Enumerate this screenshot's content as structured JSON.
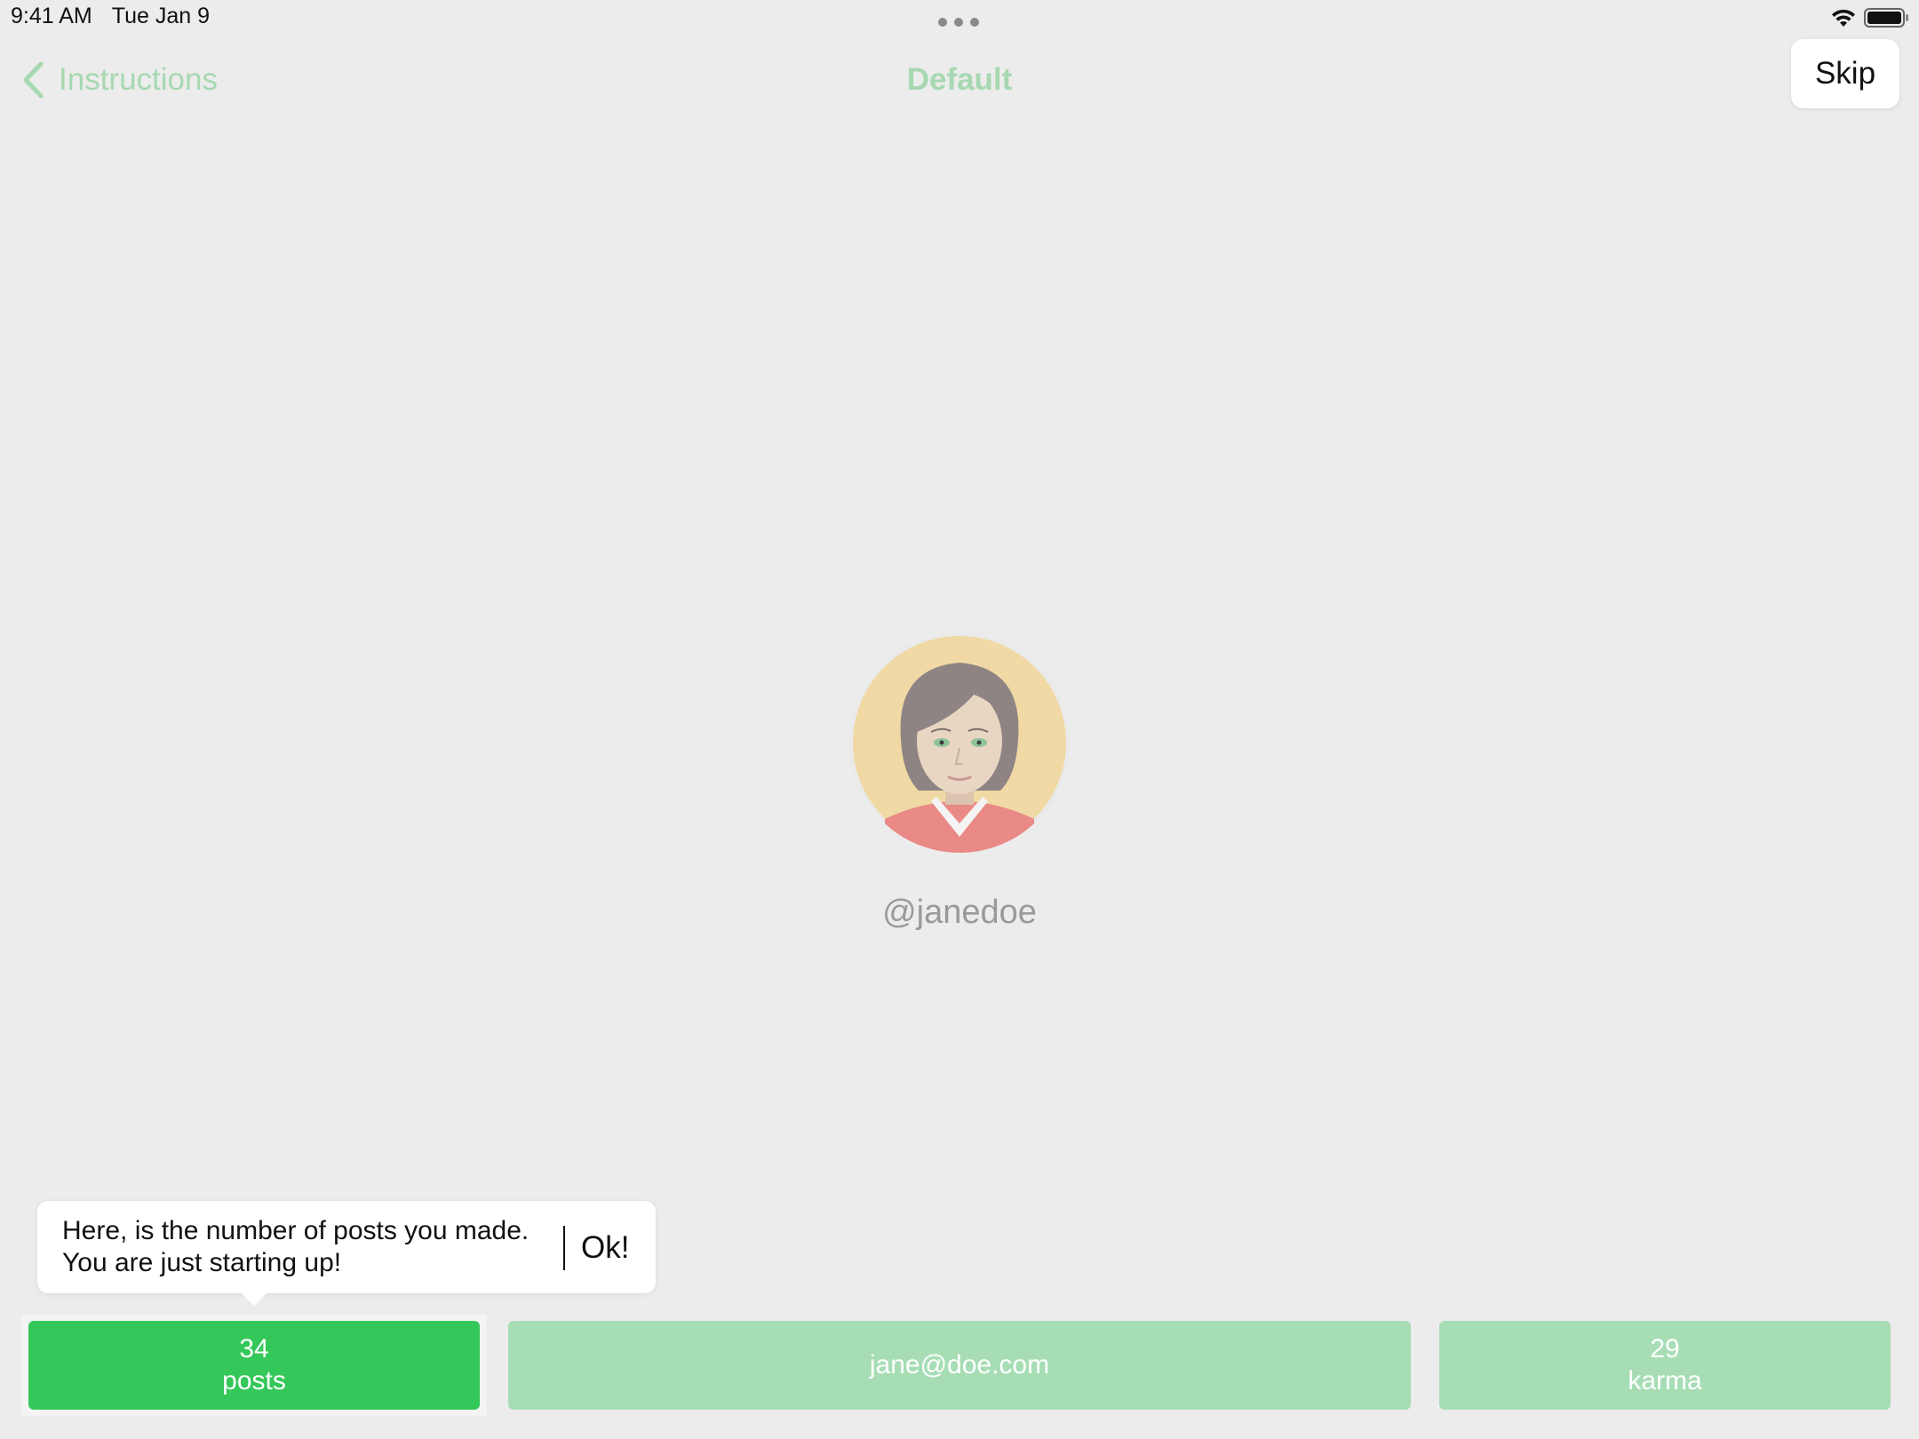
{
  "status_bar": {
    "time": "9:41 AM",
    "date": "Tue Jan 9",
    "wifi_icon": "wifi-icon",
    "battery_icon": "battery-full-icon"
  },
  "nav": {
    "back_label": "Instructions",
    "title": "Default",
    "skip_label": "Skip",
    "accent_color": "#a7d8b1"
  },
  "profile": {
    "username": "@janedoe",
    "avatar_icon": "woman-avatar"
  },
  "tooltip": {
    "line1": "Here, is the number of posts you made.",
    "line2": "You are just starting up!",
    "ok_label": "Ok!"
  },
  "stats": {
    "posts": {
      "value": "34",
      "label": "posts",
      "color": "#34c759"
    },
    "email": {
      "value": "jane@doe.com",
      "color": "#a7ddb5"
    },
    "karma": {
      "value": "29",
      "label": "karma",
      "color": "#a7ddb5"
    }
  }
}
